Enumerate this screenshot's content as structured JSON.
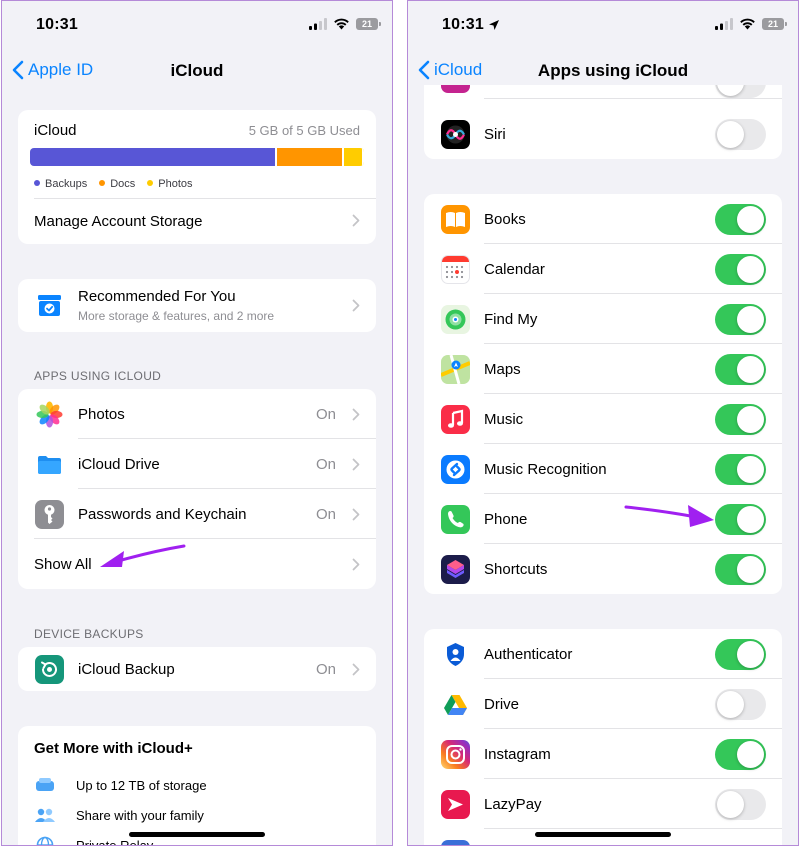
{
  "left": {
    "status": {
      "time": "10:31",
      "battery": "21"
    },
    "nav": {
      "back": "Apple ID",
      "title": "iCloud"
    },
    "storage": {
      "title": "iCloud",
      "used": "5 GB of 5 GB Used",
      "segments": [
        {
          "name": "Backups",
          "color": "#5856d6",
          "fraction": 0.74
        },
        {
          "name": "Docs",
          "color": "#ff9500",
          "fraction": 0.2
        },
        {
          "name": "Photos",
          "color": "#ffcc00",
          "fraction": 0.06
        }
      ],
      "legend": [
        "Backups",
        "Docs",
        "Photos"
      ],
      "manage": "Manage Account Storage"
    },
    "recommended": {
      "title": "Recommended For You",
      "subtitle": "More storage & features, and 2 more"
    },
    "apps_header": "APPS USING ICLOUD",
    "apps": [
      {
        "label": "Photos",
        "value": "On"
      },
      {
        "label": "iCloud Drive",
        "value": "On"
      },
      {
        "label": "Passwords and Keychain",
        "value": "On"
      }
    ],
    "show_all": "Show All",
    "backups_header": "DEVICE BACKUPS",
    "backup": {
      "label": "iCloud Backup",
      "value": "On"
    },
    "plus": {
      "title": "Get More with iCloud+",
      "features": [
        "Up to 12 TB of storage",
        "Share with your family",
        "Private Relay"
      ]
    }
  },
  "right": {
    "status": {
      "time": "10:31",
      "battery": "21"
    },
    "nav": {
      "back": "iCloud",
      "title": "Apps using iCloud"
    },
    "group1": [
      {
        "label": "Siri",
        "on": false
      }
    ],
    "group2": [
      {
        "label": "Books",
        "on": true
      },
      {
        "label": "Calendar",
        "on": true
      },
      {
        "label": "Find My",
        "on": true
      },
      {
        "label": "Maps",
        "on": true
      },
      {
        "label": "Music",
        "on": true
      },
      {
        "label": "Music Recognition",
        "on": true
      },
      {
        "label": "Phone",
        "on": true
      },
      {
        "label": "Shortcuts",
        "on": true
      }
    ],
    "group3": [
      {
        "label": "Authenticator",
        "on": true
      },
      {
        "label": "Drive",
        "on": false
      },
      {
        "label": "Instagram",
        "on": true
      },
      {
        "label": "LazyPay",
        "on": false
      }
    ]
  },
  "colors": {
    "accent": "#0a84ff",
    "toggle_on": "#34c759",
    "annotation": "#a020f0"
  }
}
